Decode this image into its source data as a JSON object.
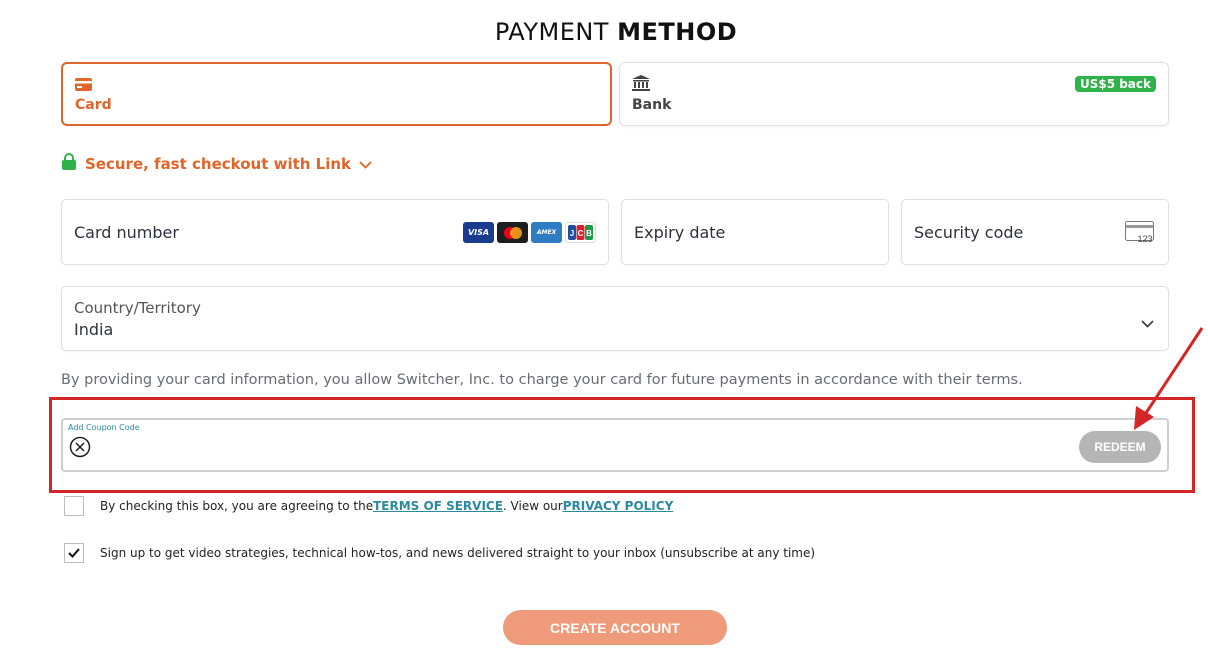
{
  "title": {
    "part1": "PAYMENT ",
    "part2": "METHOD"
  },
  "payment_methods": {
    "card": {
      "label": "Card",
      "icon": "credit-card-icon",
      "selected": true
    },
    "bank": {
      "label": "Bank",
      "icon": "bank-icon",
      "badge": "US$5 back"
    }
  },
  "link": {
    "text": "Secure, fast checkout with Link",
    "icon": "lock-icon"
  },
  "card_fields": {
    "card_number_placeholder": "Card number",
    "brands": [
      "VISA",
      "mastercard",
      "AMEX",
      "JCB"
    ],
    "expiry_placeholder": "Expiry date",
    "security_placeholder": "Security code",
    "cvc_icon_text": "123"
  },
  "country": {
    "label": "Country/Territory",
    "value": "India"
  },
  "authorization_text": "By providing your card information, you allow Switcher, Inc. to charge your card for future payments in accordance with their terms.",
  "coupon": {
    "label": "Add Coupon Code",
    "value": "",
    "redeem_label": "REDEEM"
  },
  "terms": {
    "prefix": "By checking this box, you are agreeing to the ",
    "tos_link": "TERMS OF SERVICE",
    "middle": ". View our ",
    "privacy_link": "PRIVACY POLICY",
    "checked": false
  },
  "newsletter": {
    "text": "Sign up to get video strategies, technical how-tos, and news delivered straight to your inbox (unsubscribe at any time)",
    "checked": true
  },
  "create_button": "CREATE ACCOUNT",
  "colors": {
    "accent": "#e0652a",
    "badge_green": "#2eb34a",
    "link_teal": "#2a8aa0",
    "highlight_red": "#d42626",
    "create_button": "#ef9a7a"
  }
}
